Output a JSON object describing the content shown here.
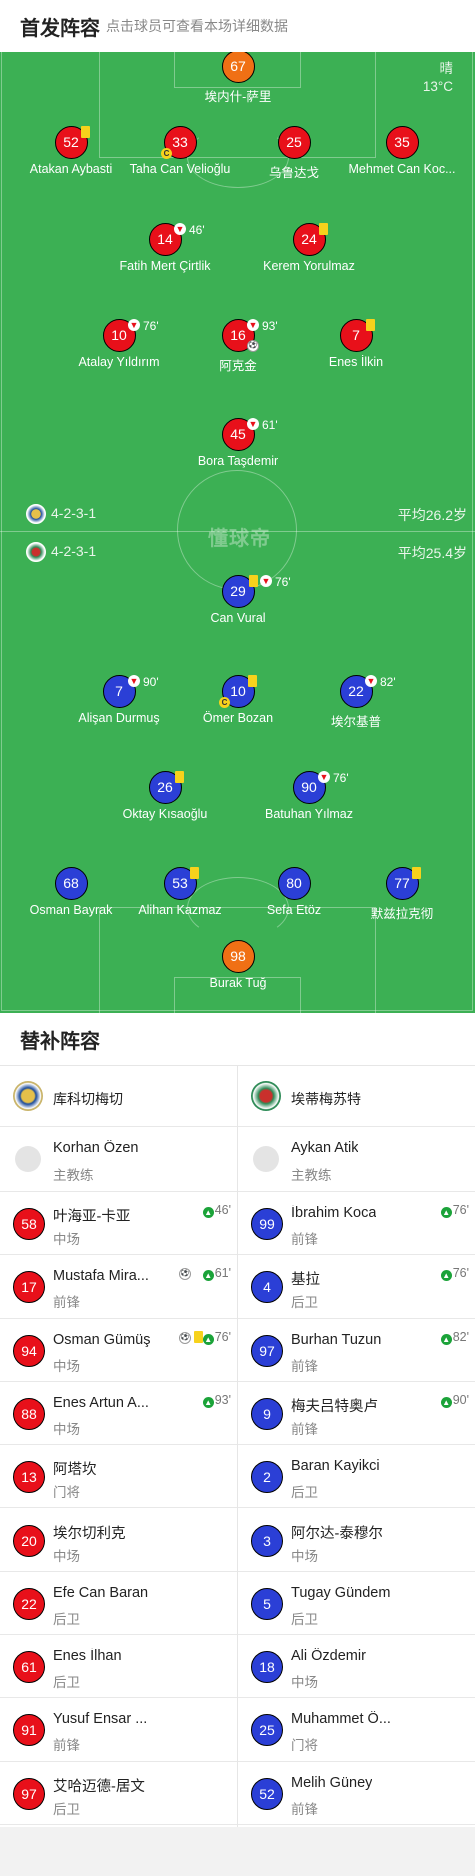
{
  "header": {
    "title": "首发阵容",
    "subtitle": "点击球员可查看本场详细数据"
  },
  "weather": {
    "condition": "晴",
    "temp": "13°C"
  },
  "watermark": "懂球帝",
  "home_formation": {
    "label": "4-2-3-1",
    "avg_age": "平均26.2岁"
  },
  "away_formation": {
    "label": "4-2-3-1",
    "avg_age": "平均25.4岁"
  },
  "home_players": [
    {
      "num": "67",
      "name": "埃内什-萨里"
    },
    {
      "num": "52",
      "name": "Atakan Aybasti"
    },
    {
      "num": "33",
      "name": "Taha Can Velioğlu"
    },
    {
      "num": "25",
      "name": "乌鲁达戈"
    },
    {
      "num": "35",
      "name": "Mehmet Can Koc..."
    },
    {
      "num": "14",
      "name": "Fatih Mert Çirtlik",
      "sub": "46'"
    },
    {
      "num": "24",
      "name": "Kerem Yorulmaz"
    },
    {
      "num": "10",
      "name": "Atalay Yıldırım",
      "sub": "76'"
    },
    {
      "num": "16",
      "name": "阿克金",
      "sub": "93'"
    },
    {
      "num": "7",
      "name": "Enes İlkin"
    },
    {
      "num": "45",
      "name": "Bora Taşdemir",
      "sub": "61'"
    }
  ],
  "away_players": [
    {
      "num": "29",
      "name": "Can Vural",
      "sub": "76'"
    },
    {
      "num": "7",
      "name": "Alişan Durmuş",
      "sub": "90'"
    },
    {
      "num": "10",
      "name": "Ömer Bozan"
    },
    {
      "num": "22",
      "name": "埃尔基普",
      "sub": "82'"
    },
    {
      "num": "26",
      "name": "Oktay Kısaoğlu"
    },
    {
      "num": "90",
      "name": "Batuhan Yılmaz",
      "sub": "76'"
    },
    {
      "num": "68",
      "name": "Osman Bayrak"
    },
    {
      "num": "53",
      "name": "Alihan Kazmaz"
    },
    {
      "num": "80",
      "name": "Sefa Etöz"
    },
    {
      "num": "77",
      "name": "默兹拉克彻"
    },
    {
      "num": "98",
      "name": "Burak Tuğ"
    }
  ],
  "subs": {
    "title": "替补阵容",
    "home": {
      "team": "库科切梅切",
      "coach": {
        "name": "Korhan Özen",
        "role": "主教练"
      },
      "players": [
        {
          "num": "58",
          "name": "叶海亚-卡亚",
          "pos": "中场",
          "time": "46'"
        },
        {
          "num": "17",
          "name": "Mustafa Mira...",
          "pos": "前锋",
          "time": "61'"
        },
        {
          "num": "94",
          "name": "Osman Gümüş",
          "pos": "中场",
          "time": "76'"
        },
        {
          "num": "88",
          "name": "Enes Artun A...",
          "pos": "中场",
          "time": "93'"
        },
        {
          "num": "13",
          "name": "阿塔坎",
          "pos": "门将",
          "time": ""
        },
        {
          "num": "20",
          "name": "埃尔切利克",
          "pos": "中场",
          "time": ""
        },
        {
          "num": "22",
          "name": "Efe Can Baran",
          "pos": "后卫",
          "time": ""
        },
        {
          "num": "61",
          "name": "Enes İlhan",
          "pos": "后卫",
          "time": ""
        },
        {
          "num": "91",
          "name": "Yusuf Ensar ...",
          "pos": "前锋",
          "time": ""
        },
        {
          "num": "97",
          "name": "艾哈迈德-居文",
          "pos": "后卫",
          "time": ""
        }
      ]
    },
    "away": {
      "team": "埃蒂梅苏特",
      "coach": {
        "name": "Aykan Atik",
        "role": "主教练"
      },
      "players": [
        {
          "num": "99",
          "name": "İbrahim Koca",
          "pos": "前锋",
          "time": "76'"
        },
        {
          "num": "4",
          "name": "基拉",
          "pos": "后卫",
          "time": "76'"
        },
        {
          "num": "97",
          "name": "Burhan Tuzun",
          "pos": "前锋",
          "time": "82'"
        },
        {
          "num": "9",
          "name": "梅夫吕特奥卢",
          "pos": "前锋",
          "time": "90'"
        },
        {
          "num": "2",
          "name": "Baran Kayikci",
          "pos": "后卫",
          "time": ""
        },
        {
          "num": "3",
          "name": "阿尔达-泰穆尔",
          "pos": "中场",
          "time": ""
        },
        {
          "num": "5",
          "name": "Tugay Gündem",
          "pos": "后卫",
          "time": ""
        },
        {
          "num": "18",
          "name": "Ali Özdemir",
          "pos": "中场",
          "time": ""
        },
        {
          "num": "25",
          "name": "Muhammet Ö...",
          "pos": "门将",
          "time": ""
        },
        {
          "num": "52",
          "name": "Melih Güney",
          "pos": "前锋",
          "time": ""
        }
      ]
    }
  },
  "colors": {
    "pitch": "#3cb054",
    "home": "#e8101a",
    "away": "#2b3fd6",
    "keeper": "#f07015",
    "yellow_card": "#f7d21c",
    "sub_in": "#1ba339"
  }
}
